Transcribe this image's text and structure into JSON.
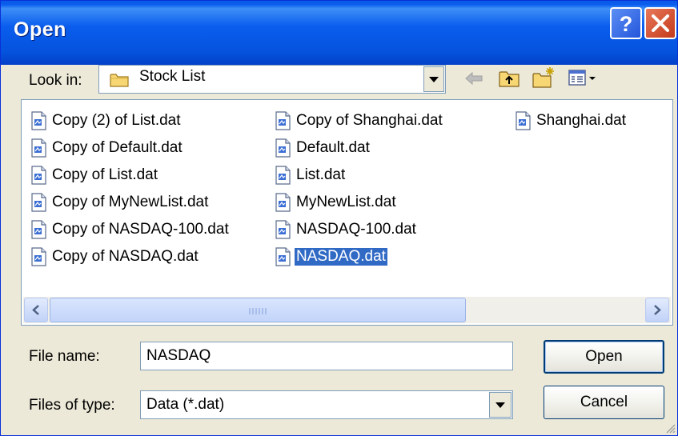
{
  "window": {
    "title": "Open"
  },
  "titlebar": {
    "help_icon": "help-icon",
    "close_icon": "close-icon"
  },
  "look_in": {
    "label": "Look in:",
    "value": "Stock List",
    "icon": "folder-icon"
  },
  "toolbar": {
    "back_icon": "back-arrow-icon",
    "up_icon": "up-one-level-icon",
    "new_folder_icon": "new-folder-icon",
    "view_menu_icon": "view-menu-icon"
  },
  "files": {
    "columns": [
      [
        "Copy (2) of List.dat",
        "Copy of Default.dat",
        "Copy of List.dat",
        "Copy of MyNewList.dat",
        "Copy of NASDAQ-100.dat",
        "Copy of NASDAQ.dat"
      ],
      [
        "Copy of Shanghai.dat",
        "Default.dat",
        "List.dat",
        "MyNewList.dat",
        "NASDAQ-100.dat",
        "NASDAQ.dat"
      ],
      [
        "Shanghai.dat"
      ]
    ],
    "selected": "NASDAQ.dat"
  },
  "file_name": {
    "label": "File name:",
    "value": "NASDAQ"
  },
  "file_type": {
    "label": "Files of type:",
    "value": "Data (*.dat)"
  },
  "buttons": {
    "open": "Open",
    "cancel": "Cancel"
  },
  "colors": {
    "title_blue": "#0A5DEE",
    "selection": "#316AC5",
    "dialog_bg": "#ECE9D8"
  }
}
